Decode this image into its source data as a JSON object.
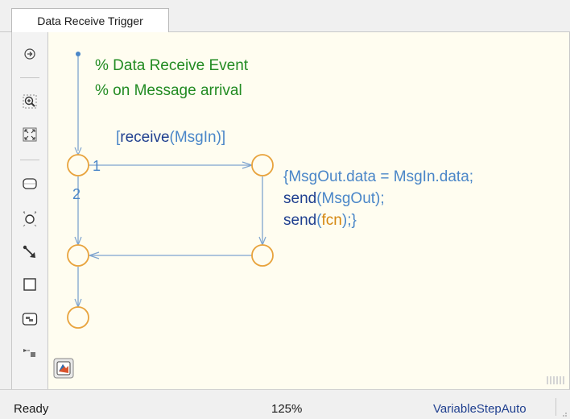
{
  "tab": {
    "title": "Data Receive Trigger"
  },
  "toolbar": {
    "items": [
      {
        "icon": "hide-show-explorer-icon"
      },
      {
        "icon": "zoom-in-icon"
      },
      {
        "icon": "fit-to-view-icon"
      },
      {
        "icon": "state-tool-icon"
      },
      {
        "icon": "junction-tool-icon"
      },
      {
        "icon": "default-transition-icon"
      },
      {
        "icon": "box-tool-icon"
      },
      {
        "icon": "function-tool-icon"
      },
      {
        "icon": "port-tool-icon"
      },
      {
        "icon": "app-logo-icon"
      }
    ]
  },
  "chart": {
    "comment_line1": "% Data Receive Event",
    "comment_line2": "% on Message arrival",
    "condition_open": "[",
    "condition_func": "receive",
    "condition_paren_open": "(",
    "condition_arg": "MsgIn",
    "condition_close": ")]",
    "order_1": "1",
    "order_2": "2",
    "action_line1": "{MsgOut.data = MsgIn.data;",
    "action_send1": "send",
    "action_send1_arg": "(MsgOut);",
    "action_send2": "send",
    "action_paren_open": "(",
    "action_send2_arg": "fcn",
    "action_close": ");}"
  },
  "status": {
    "state": "Ready",
    "zoom": "125%",
    "solver": "VariableStepAuto"
  },
  "colors": {
    "comment": "#228b22",
    "label_blue": "#4a86c8",
    "keyword": "#1f3f8f",
    "orange": "#d4860e",
    "junction": "#e8a33d",
    "transition": "#7ea4cf",
    "canvas": "#fffdf0"
  }
}
